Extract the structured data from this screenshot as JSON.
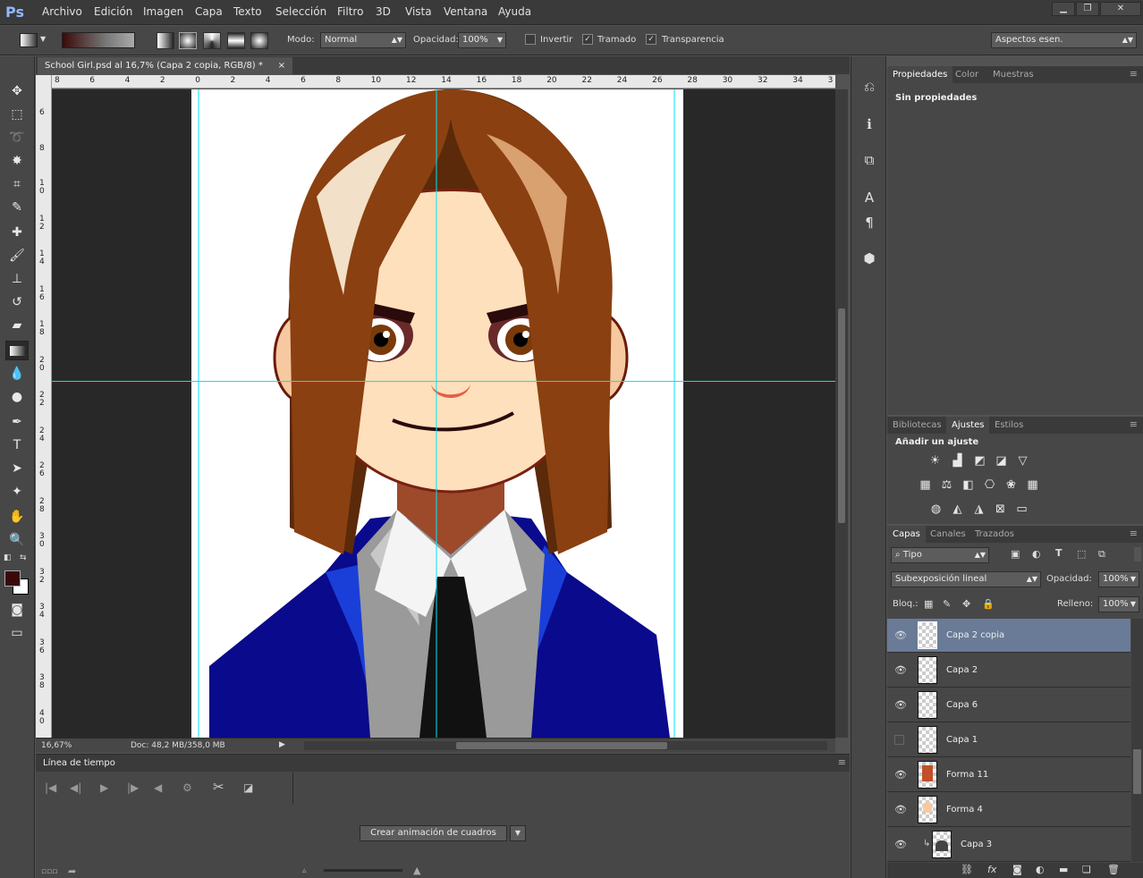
{
  "app": {
    "logo": "Ps"
  },
  "menu": [
    "Archivo",
    "Edición",
    "Imagen",
    "Capa",
    "Texto",
    "Selección",
    "Filtro",
    "3D",
    "Vista",
    "Ventana",
    "Ayuda"
  ],
  "window_controls": {
    "minimize": "▁",
    "restore": "❐",
    "close": "✕"
  },
  "options": {
    "mode_label": "Modo:",
    "mode_value": "Normal",
    "opacity_label": "Opacidad:",
    "opacity_value": "100%",
    "invert_label": "Invertir",
    "dither_label": "Tramado",
    "transparency_label": "Transparencia",
    "workspace_value": "Aspectos esen."
  },
  "document": {
    "tab_title": "School Girl.psd al 16,7% (Capa 2 copia, RGB/8) *",
    "close_glyph": "×",
    "zoom": "16,67%",
    "doc_info": "Doc: 48,2 MB/358,0 MB"
  },
  "ruler_h": [
    "8",
    "6",
    "4",
    "2",
    "0",
    "2",
    "4",
    "6",
    "8",
    "10",
    "12",
    "14",
    "16",
    "18",
    "20",
    "22",
    "24",
    "26",
    "28",
    "30",
    "32",
    "34",
    "3"
  ],
  "ruler_v": [
    "6",
    "8",
    "1 0",
    "1 2",
    "1 4",
    "1 6",
    "1 8",
    "2 0",
    "2 2",
    "2 4",
    "2 6",
    "2 8",
    "3 0",
    "3 2",
    "3 4",
    "3 6",
    "3 8",
    "4 0"
  ],
  "timeline": {
    "title": "Línea de tiempo",
    "create_button": "Crear animación de cuadros"
  },
  "properties_panel": {
    "tabs": [
      "Propiedades",
      "Color",
      "Muestras"
    ],
    "content": "Sin propiedades"
  },
  "adjustments_panel": {
    "tabs": [
      "Bibliotecas",
      "Ajustes",
      "Estilos"
    ],
    "heading": "Añadir un ajuste"
  },
  "layers_panel": {
    "tabs": [
      "Capas",
      "Canales",
      "Trazados"
    ],
    "filter_kind": "Tipo",
    "blend_mode": "Subexposición lineal",
    "opacity_label": "Opacidad:",
    "opacity_value": "100%",
    "lock_label": "Bloq.:",
    "fill_label": "Relleno:",
    "fill_value": "100%",
    "layers": [
      {
        "name": "Capa 2 copia",
        "visible": true,
        "selected": true
      },
      {
        "name": "Capa 2",
        "visible": true,
        "selected": false
      },
      {
        "name": "Capa 6",
        "visible": true,
        "selected": false
      },
      {
        "name": "Capa 1",
        "visible": false,
        "selected": false
      },
      {
        "name": "Forma 11",
        "visible": true,
        "selected": false
      },
      {
        "name": "Forma 4",
        "visible": true,
        "selected": false
      },
      {
        "name": "Capa 3",
        "visible": true,
        "selected": false
      }
    ]
  },
  "colors": {
    "foreground": "#3a0a0a",
    "background": "#ffffff",
    "selected_layer": "#697b96",
    "guide": "#00e5ff"
  }
}
